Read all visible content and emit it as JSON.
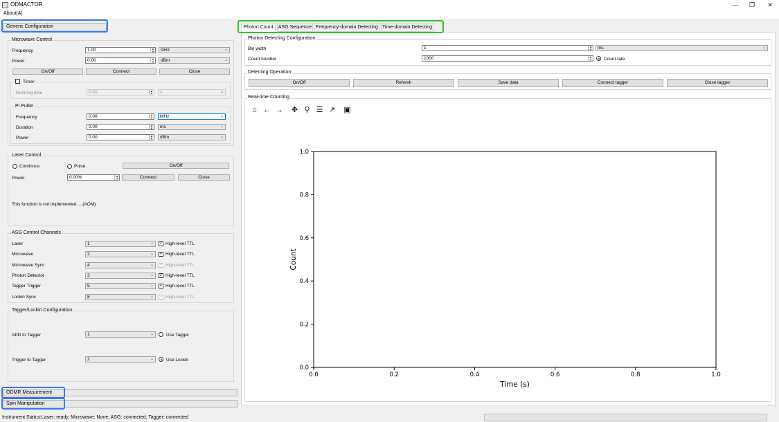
{
  "window": {
    "title": "ODMACTOR",
    "minimize": "—",
    "maximize": "❐",
    "close": "✕"
  },
  "menu": {
    "about": "About(A)"
  },
  "left": {
    "generic_config": "Generic Configuration",
    "microwave": {
      "title": "Microwave Control",
      "frequency_label": "Frequency",
      "frequency_value": "1.00",
      "frequency_unit": "GHz",
      "power_label": "Power",
      "power_value": "0.00",
      "power_unit": "dBm",
      "onoff": "On/Off",
      "connect": "Connect",
      "close": "Close",
      "timer_label": "Timer",
      "running_time_label": "Running time",
      "running_time_value": "0.00",
      "running_time_unit": "s",
      "pi_pulse_title": "Pi Pulse",
      "pi_frequency_label": "Frequency",
      "pi_frequency_value": "0.00",
      "pi_frequency_unit": "MHz",
      "pi_duration_label": "Duration",
      "pi_duration_value": "0.00",
      "pi_duration_unit": "ms",
      "pi_power_label": "Power",
      "pi_power_value": "0.00",
      "pi_power_unit": "dBm"
    },
    "laser": {
      "title": "Laser Control",
      "continous": "Continous",
      "pulse": "Pulse",
      "onoff": "On/Off",
      "power_label": "Power",
      "power_value": "0.00%",
      "connect": "Connect",
      "close": "Close",
      "note": "This function is not implemented ....(AOM)"
    },
    "asg": {
      "title": "ASG Control Channels",
      "ttl_label": "High-level TTL",
      "channels": [
        {
          "name": "Laser",
          "value": "1",
          "checked": true,
          "enabled": true
        },
        {
          "name": "Microwave",
          "value": "2",
          "checked": true,
          "enabled": true
        },
        {
          "name": "Microwave Sync",
          "value": "4",
          "checked": true,
          "enabled": false
        },
        {
          "name": "Photon Detector",
          "value": "3",
          "checked": true,
          "enabled": true
        },
        {
          "name": "Tagger Trigger",
          "value": "5",
          "checked": true,
          "enabled": true
        },
        {
          "name": "Lockin Sync",
          "value": "8",
          "checked": true,
          "enabled": false
        }
      ]
    },
    "tagger": {
      "title": "Tagger/Lockin Configuration",
      "apd_label": "APD to Tagger",
      "apd_value": "1",
      "use_tagger": "Use Tagger",
      "trigger_label": "Trigger to Tagger",
      "trigger_value": "2",
      "use_lockin": "Use Lockin"
    },
    "odmr_measurement": "ODMR Measurement",
    "spin_manipulation": "Spin Manipulation"
  },
  "tabs": [
    "Photon Count",
    "ASG Sequence",
    "Frequency-domain Detecting",
    "Time-domain Detecting"
  ],
  "photon": {
    "config_title": "Photon Detecting Configuration",
    "bin_width_label": "Bin width",
    "bin_width_value": "1",
    "bin_width_unit": "ms",
    "count_number_label": "Count number",
    "count_number_value": "1000",
    "count_rate": "Count rate",
    "operation_title": "Detecting Operation",
    "buttons": [
      "On/Off",
      "Refresh",
      "Save data",
      "Connect tagger",
      "Close tagger"
    ],
    "realtime_title": "Real-time Counting"
  },
  "toolbar_icons": [
    "home-icon",
    "back-arrow-icon",
    "forward-arrow-icon",
    "pan-icon",
    "zoom-icon",
    "configure-icon",
    "edit-axis-icon",
    "save-icon"
  ],
  "chart_data": {
    "type": "line",
    "xlabel": "Time (s)",
    "ylabel": "Count",
    "xlim": [
      0.0,
      1.0
    ],
    "ylim": [
      0.0,
      1.0
    ],
    "xticks": [
      "0.0",
      "0.2",
      "0.4",
      "0.6",
      "0.8",
      "1.0"
    ],
    "yticks": [
      "0.0",
      "0.2",
      "0.4",
      "0.6",
      "0.8",
      "1.0"
    ],
    "series": []
  },
  "status": {
    "text": "Instrument Status:Laser: ready, Microwave: None, ASG: connected, Tagger: connected"
  }
}
